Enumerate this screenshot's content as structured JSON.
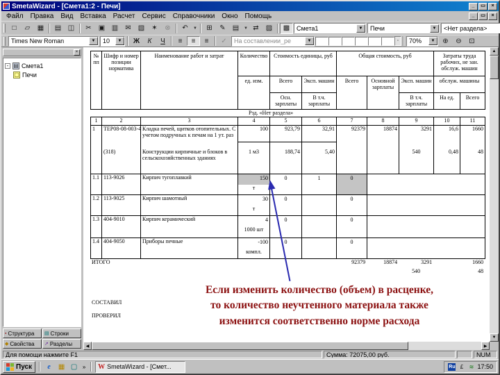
{
  "window": {
    "title": "SmetaWizard - [Смета1:2 - Печи]"
  },
  "menu": {
    "items": [
      "Файл",
      "Правка",
      "Вид",
      "Вставка",
      "Расчет",
      "Сервис",
      "Справочники",
      "Окно",
      "Помощь"
    ]
  },
  "toolbar1": {
    "estimate": "Смета1",
    "sheet": "Печи",
    "section": "<Нет раздела>"
  },
  "toolbar2": {
    "font": "Times New Roman",
    "size": "10",
    "bold": "Ж",
    "italic": "К",
    "underline": "Ч",
    "status": "На составлении_ре",
    "zoom": "70%"
  },
  "icons": {
    "dd": "▼",
    "min": "_",
    "max": "▭",
    "close": "×",
    "new": "□",
    "open": "▱",
    "save": "▦",
    "print": "▤",
    "preview": "◫",
    "cut": "✂",
    "copy": "▣",
    "paste": "▥",
    "mail": "✉",
    "sheet2": "▧",
    "wizard": "✶",
    "link": "⊗",
    "undo": "↶",
    "table": "⊞",
    "draw": "✎",
    "insertrows": "▤",
    "move": "⇄",
    "props": "▨",
    "structure": "▩",
    "find": "◉",
    "refresh": "⊙",
    "alignleft": "≡",
    "aligncenter": "≡",
    "alignright": "≡",
    "bird": "✓",
    "cellbtn": "▫",
    "zoomin": "⊕",
    "zoomout": "⊖",
    "zoomfit": "⊡",
    "panelclose": "×",
    "treeminus": "-",
    "treedoc": "▤",
    "treepage": "▢",
    "tabstruct": "▪",
    "tabrows": "▤",
    "tabprops": "◆",
    "tabsections": "↗",
    "qlie": "e",
    "qlmail": "▦",
    "qldesk": "▢",
    "qlmore": "»",
    "traylang": "Ru",
    "tray2": "£",
    "tray3": "≋",
    "vsup": "▲",
    "vsdn": "▼",
    "hsl": "◀",
    "hsr": "▶",
    "taskw": "W"
  },
  "sidebar": {
    "root": "Смета1",
    "child": "Печи",
    "tabs": [
      "Структура",
      "Строки",
      "Свойства",
      "Разделы"
    ]
  },
  "table": {
    "h": {
      "c1": "№ пп",
      "c2": "Шифр и номер позиции норматива",
      "c3": "Наименование работ и затрат",
      "c4a": "Количество",
      "c4b": "ед. изм.",
      "unit": "Стоимость единицы, руб",
      "total": "Общая стоимость, руб",
      "labor": "Затраты труда рабочих, не зан. обслуж. машин",
      "c5a": "Всего",
      "c5b": "Осн. зарплаты",
      "c6a": "Эксп. машин",
      "c6b": "В т.ч. зарплаты",
      "c7": "Всего",
      "c8": "Основной зарплаты",
      "c9a": "Эксп. машин",
      "c9b": "В т.ч. зарплаты",
      "mach": "обслуж. машины",
      "c10": "На ед.",
      "c11": "Всего"
    },
    "nums": [
      "1",
      "2",
      "3",
      "4",
      "5",
      "6",
      "7",
      "8",
      "9",
      "10",
      "11"
    ],
    "section": "Рзд. «Нет раздела»",
    "r1": {
      "n": "1",
      "code": "ТЕР08-08-003-4",
      "name": "Кладка печей, щитков отопительных. С учетом подручных к печам на 1 ут. раз",
      "qty": "100",
      "c5": "923,79",
      "c6": "32,91",
      "c7": "92379",
      "c8": "18874",
      "c9": "3291",
      "c10": "16,6",
      "c11": "1660",
      "code2": "(318)",
      "name2": "Конструкции кирпичные и блоков в сельскохозяйственных зданиях",
      "qty2": "1 м3",
      "c5b": "188,74",
      "c6b": "5,40",
      "c9b": "540",
      "c10b": "0,48",
      "c11b": "48"
    },
    "m": [
      {
        "n": "1.1",
        "code": "113-9026",
        "name": "Кирпич тугоплавкий",
        "qty": "150",
        "unit": "т",
        "c5": "0",
        "c6": "1",
        "c7": "0"
      },
      {
        "n": "1.2",
        "code": "113-9025",
        "name": "Кирпич шамотный",
        "qty": "30",
        "unit": "т",
        "c5": "0",
        "c6": "",
        "c7": "0"
      },
      {
        "n": "1.3",
        "code": "404-9010",
        "name": "Кирпич керамический",
        "qty": "4",
        "unit": "1000 шт",
        "c5": "0",
        "c6": "",
        "c7": "0"
      },
      {
        "n": "1.4",
        "code": "404-9050",
        "name": "Приборы печные",
        "qty": "-100",
        "unit": "компл.",
        "c5": "0",
        "c6": "",
        "c7": "0"
      }
    ],
    "itogo": {
      "label": "ИТОГО",
      "c7": "92379",
      "c8": "18874",
      "c9": "3291",
      "c11": "1660",
      "c9b": "540",
      "c11b": "48"
    },
    "sig1": "СОСТАВИЛ",
    "sig2": "ПРОВЕРИЛ"
  },
  "annotation": {
    "l1": "Если изменить количество (объем) в расценке,",
    "l2": "то количество неучтенного материала также",
    "l3": "изменится соответственно норме расхода"
  },
  "statusbar": {
    "help": "Для помощи нажмите F1",
    "sum": "Сумма: 72075,00 руб.",
    "num": "NUM"
  },
  "taskbar": {
    "start": "Пуск",
    "task": "SmetaWizard - [Смет...",
    "time": "17:50"
  }
}
